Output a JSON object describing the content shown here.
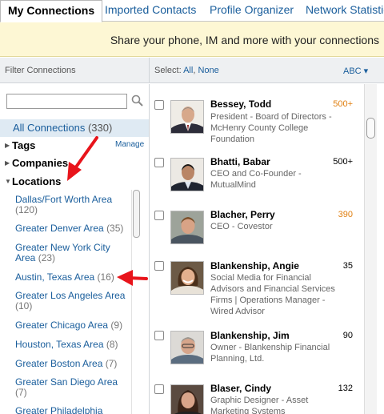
{
  "tabs": [
    {
      "label": "My Connections"
    },
    {
      "label": "Imported Contacts"
    },
    {
      "label": "Profile Organizer"
    },
    {
      "label": "Network Statistic"
    }
  ],
  "banner": {
    "text": "Share your phone, IM and more with your connections"
  },
  "filter": {
    "header": "Filter Connections",
    "all_label": "All Connections",
    "all_count": "(330)",
    "tags_label": "Tags",
    "manage_label": "Manage",
    "companies_label": "Companies",
    "locations_label": "Locations",
    "locations": [
      {
        "name": "Dallas/Fort Worth Area",
        "count": "(120)"
      },
      {
        "name": "Greater Denver Area",
        "count": "(35)"
      },
      {
        "name": "Greater New York City Area",
        "count": "(23)"
      },
      {
        "name": "Austin, Texas Area",
        "count": "(16)"
      },
      {
        "name": "Greater Los Angeles Area",
        "count": "(10)"
      },
      {
        "name": "Greater Chicago Area",
        "count": "(9)"
      },
      {
        "name": "Houston, Texas Area",
        "count": "(8)"
      },
      {
        "name": "Greater Boston Area",
        "count": "(7)"
      },
      {
        "name": "Greater San Diego Area",
        "count": "(7)"
      },
      {
        "name": "Greater Philadelphia",
        "count": ""
      }
    ]
  },
  "select": {
    "label": "Select:",
    "all": "All",
    "separator": ",",
    "none": "None",
    "sort": "ABC ▾"
  },
  "contacts": [
    {
      "name": "Bessey, Todd",
      "count": "500+",
      "count_color": "orange",
      "title": "President - Board of Directors - McHenry County College Foundation"
    },
    {
      "name": "Bhatti, Babar",
      "count": "500+",
      "count_color": "black",
      "title": "CEO and Co-Founder - MutualMind"
    },
    {
      "name": "Blacher, Perry",
      "count": "390",
      "count_color": "orange",
      "title": "CEO - Covestor"
    },
    {
      "name": "Blankenship, Angie",
      "count": "35",
      "count_color": "black",
      "title": "Social Media for Financial Advisors and Financial Services Firms | Operations Manager - Wired Advisor"
    },
    {
      "name": "Blankenship, Jim",
      "count": "90",
      "count_color": "black",
      "title": "Owner - Blankenship Financial Planning, Ltd."
    },
    {
      "name": "Blaser, Cindy",
      "count": "132",
      "count_color": "black",
      "title": "Graphic Designer - Asset Marketing Systems"
    }
  ],
  "colors": {
    "link": "#1a5e9c",
    "orange_count": "#e07f10",
    "banner_bg": "#fdf7d4",
    "selected_bg": "#dfeaf3",
    "arrow": "#e8141b"
  }
}
